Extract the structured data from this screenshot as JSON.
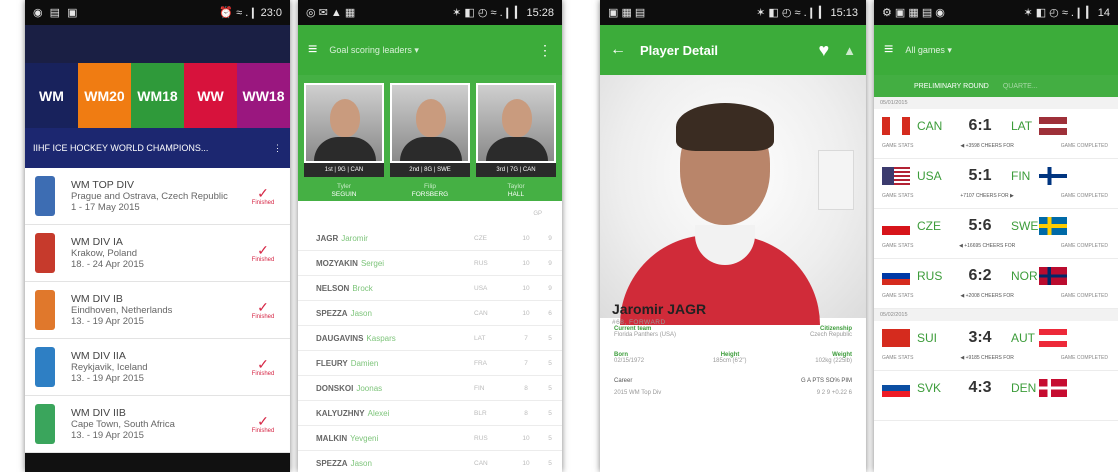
{
  "phone1": {
    "status": {
      "left": "◉ ▤ ▣",
      "right": "⏰ ≈ .❙ 23:0"
    },
    "tabs": [
      {
        "label": "WM",
        "color": "#18225c"
      },
      {
        "label": "WM20",
        "color": "#f07c12"
      },
      {
        "label": "WM18",
        "color": "#2f9a3a"
      },
      {
        "label": "WW",
        "color": "#d7123c"
      },
      {
        "label": "WW18",
        "color": "#9a177f"
      }
    ],
    "banner": "IIHF ICE HOCKEY WORLD CHAMPIONS...",
    "banner_more": "⋮",
    "events": [
      {
        "name": "WM TOP DIV",
        "place": "Prague and Ostrava, Czech Republic",
        "dates": "1 - 17 May 2015",
        "status": "Finished",
        "logo_color": "#3d6db3"
      },
      {
        "name": "WM DIV IA",
        "place": "Krakow, Poland",
        "dates": "18. - 24 Apr 2015",
        "status": "Finished",
        "logo_color": "#c63a2c"
      },
      {
        "name": "WM DIV IB",
        "place": "Eindhoven, Netherlands",
        "dates": "13. - 19 Apr 2015",
        "status": "Finished",
        "logo_color": "#e0782c"
      },
      {
        "name": "WM DIV IIA",
        "place": "Reykjavik, Iceland",
        "dates": "13. - 19 Apr 2015",
        "status": "Finished",
        "logo_color": "#2e7fc4"
      },
      {
        "name": "WM DIV IIB",
        "place": "Cape Town, South Africa",
        "dates": "13. - 19 Apr 2015",
        "status": "Finished",
        "logo_color": "#3aa55c"
      }
    ],
    "check": "✓"
  },
  "phone2": {
    "status": {
      "left": "◎ ✉ ▲ ▦",
      "right": "✶ ◧ ◴ ≈ .❙ ▎ 15:28"
    },
    "menu": "≡",
    "title": "Goal scoring leaders ▾",
    "more": "⋮",
    "cards": [
      {
        "rank": "1st | 9G | CAN",
        "first": "Tyler",
        "last": "SEGUIN"
      },
      {
        "rank": "2nd | 8G | SWE",
        "first": "Filip",
        "last": "FORSBERG"
      },
      {
        "rank": "3rd | 7G | CAN",
        "first": "Taylor",
        "last": "HALL"
      }
    ],
    "col_header": "GP",
    "players": [
      {
        "last": "JAGR",
        "first": "Jaromir",
        "country": "CZE",
        "gp": "10",
        "g": "9"
      },
      {
        "last": "MOZYAKIN",
        "first": "Sergei",
        "country": "RUS",
        "gp": "10",
        "g": "9"
      },
      {
        "last": "NELSON",
        "first": "Brock",
        "country": "USA",
        "gp": "10",
        "g": "9"
      },
      {
        "last": "SPEZZA",
        "first": "Jason",
        "country": "CAN",
        "gp": "10",
        "g": "6"
      },
      {
        "last": "DAUGAVINS",
        "first": "Kaspars",
        "country": "LAT",
        "gp": "7",
        "g": "5"
      },
      {
        "last": "FLEURY",
        "first": "Damien",
        "country": "FRA",
        "gp": "7",
        "g": "5"
      },
      {
        "last": "DONSKOI",
        "first": "Joonas",
        "country": "FIN",
        "gp": "8",
        "g": "5"
      },
      {
        "last": "KALYUZHNY",
        "first": "Alexei",
        "country": "BLR",
        "gp": "8",
        "g": "5"
      },
      {
        "last": "MALKIN",
        "first": "Yevgeni",
        "country": "RUS",
        "gp": "10",
        "g": "5"
      },
      {
        "last": "SPEZZA",
        "first": "Jason",
        "country": "CAN",
        "gp": "10",
        "g": "5"
      }
    ]
  },
  "phone3": {
    "status": {
      "left": "▣ ▦ ▤",
      "right": "✶ ◧ ◴ ≈ .❙ ▎ 15:13"
    },
    "back": "←",
    "title": "Player Detail",
    "heart": "♥",
    "share": "▲",
    "player_name": "Jaromir JAGR",
    "position": "#68, FORWARD",
    "current_team_label": "Current team",
    "current_team": "Florida Panthers (USA)",
    "citizenship_label": "Citizenship",
    "citizenship": "Czech Republic",
    "born_label": "Born",
    "born": "02/15/1972",
    "height_label": "Height",
    "height": "185cm (6'2\")",
    "weight_label": "Weight",
    "weight": "102kg (225lb)",
    "career_label": "Career",
    "career_cols": "G   A   PTS  SO%  PIM",
    "career_row": "2015 WM Top Div",
    "career_vals": "9   2   9   +0.22   6"
  },
  "phone4": {
    "status": {
      "left": "⚙ ▣ ▦ ▤ ◉",
      "right": "✶ ◧ ◴ ≈ .❙ ▎ 14"
    },
    "menu": "≡",
    "title": "All games ▾",
    "tab1": "PRELIMINARY ROUND",
    "tab2": "QUARTE...",
    "dates": [
      "05/01/2015",
      "05/02/2015"
    ],
    "games": [
      {
        "home": "CAN",
        "away": "LAT",
        "score": "6:1",
        "cheers": "◀ +3598 CHEERS FOR",
        "hf": "can",
        "af": "lat"
      },
      {
        "home": "USA",
        "away": "FIN",
        "score": "5:1",
        "cheers": "+7107 CHEERS FOR ▶",
        "hf": "usa",
        "af": "fin"
      },
      {
        "home": "CZE",
        "away": "SWE",
        "score": "5:6",
        "cheers": "◀ +16695 CHEERS FOR",
        "hf": "cze",
        "af": "swe"
      },
      {
        "home": "RUS",
        "away": "NOR",
        "score": "6:2",
        "cheers": "◀ +2008 CHEERS FOR",
        "hf": "rus",
        "af": "nor"
      },
      {
        "home": "SUI",
        "away": "AUT",
        "score": "3:4",
        "cheers": "◀ +9185 CHEERS FOR",
        "hf": "sui",
        "af": "aut"
      },
      {
        "home": "SVK",
        "away": "DEN",
        "score": "4:3",
        "cheers": "",
        "hf": "svk",
        "af": "den"
      }
    ],
    "game_sub_left": "GAME STATS",
    "game_sub_right": "GAME COMPLETED"
  },
  "flags": {
    "can": "linear-gradient(90deg,#d52b1e 0 28%,#fff 28% 72%,#d52b1e 72%)",
    "lat": "linear-gradient(#9e3039 0 40%,#fff 40% 60%,#9e3039 60%)",
    "usa": "linear-gradient(90deg,#3c3b6e 0 42%,transparent 42%),repeating-linear-gradient(#b22234 0 2px,#fff 2px 4px)",
    "fin": "linear-gradient(90deg,transparent 30%,#003580 30% 45%,transparent 45%),linear-gradient(#fff 0 40%,#003580 40% 60%,#fff 60%)",
    "cze": "linear-gradient(#fff 0 50%,#d7141a 50%)",
    "swe": "linear-gradient(90deg,transparent 30%,#fecc00 30% 45%,transparent 45%),linear-gradient(#006aa7 0 40%,#fecc00 40% 60%,#006aa7 60%)",
    "rus": "linear-gradient(#fff 0 33%,#0039a6 33% 66%,#d52b1e 66%)",
    "nor": "linear-gradient(90deg,transparent 30%,#002868 30% 42%,transparent 42%),linear-gradient(#ba0c2f 0 42%,#002868 42% 58%,#ba0c2f 58%)",
    "sui": "#d52b1e",
    "aut": "linear-gradient(#ed2939 0 33%,#fff 33% 66%,#ed2939 66%)",
    "svk": "linear-gradient(#fff 0 33%,#0b4ea2 33% 66%,#ee1c25 66%)",
    "den": "linear-gradient(90deg,transparent 30%,#fff 30% 42%,transparent 42%),linear-gradient(#c60c30 0 42%,#fff 42% 58%,#c60c30 58%)"
  }
}
